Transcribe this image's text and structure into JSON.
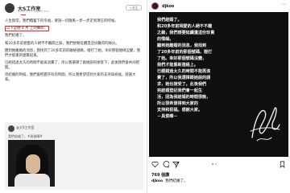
{
  "weibo": {
    "author": "大S工作室",
    "time": "2022-3-8 · 来自 iPhone",
    "follow_label": "+关注",
    "paragraphs": [
      "人生無常，我們積蓄下的幸福，要說一切隨風一步一步走到現在的時候。",
      "以下是她 8 月 上的聲明：",
      "我們結婚了。",
      "和20多年前相愛的人絕不不離開之錄，我們想要延續遺這份難得的緣分。",
      "聽到她離婚的消息，我找到了20多年前的聯絡號碼，撥打了她。幸好那個號碼沒變，我們才能重新連繫起來。",
      "已經錯過太久的時間不能再浪費了，所以我選擇了跟她說的接受下，此後我們會共同把握。",
      "完結婚的時候，我們會把握所有的時間，所以我希望得到大家的支持與祝福，感謝大家。"
    ],
    "repost": {
      "name": "@大S工作室",
      "text": "我們結婚了。#具俊曄#"
    }
  },
  "instagram": {
    "username": "djkoo",
    "more_icon": "more-icon",
    "message_lines": [
      "我們結婚了。",
      "和20多年前相愛的人絕不不離",
      "之錄，我們想要延續遺這份珍貴",
      "的情緣。",
      "聽到她離婚的消息，我找到",
      "了20多年前的那個號碼，撥打",
      "了她。幸好那個號碼沒變，",
      "我們才能重新連絡上。",
      "已經錯過太久的時間不能再浪",
      "費了，所以我選擇跟她說的請",
      "求，她也接受了。此後我們",
      "完結婚登記我們會一起生",
      "活，因為我結婚的時間很晚，",
      "所以很希望得到大家的",
      "支持和祝福。感謝大家。",
      "－具俊曄－"
    ],
    "likes": "769 個讚",
    "caption_user": "djkoo",
    "caption_text": "我們結婚了。",
    "colors": {
      "accent": "#3897f0",
      "image_bg": "#101010",
      "text_on_image": "#f3f3f3"
    }
  }
}
